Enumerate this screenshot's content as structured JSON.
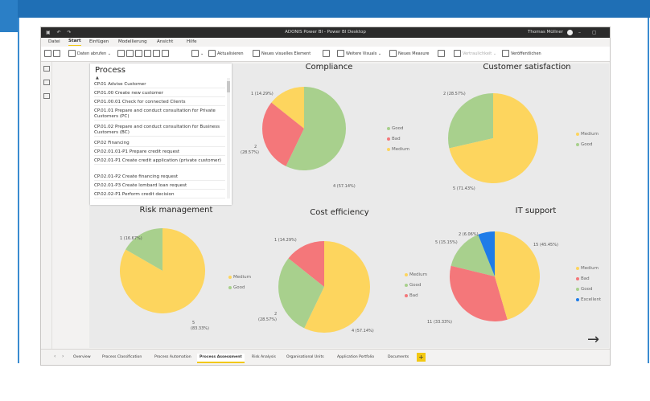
{
  "titlebar": {
    "title": "ADONIS Power BI - Power BI Desktop",
    "user": "Thomas Müllner",
    "qat": "▣ ↶ ↷",
    "window_controls": "– ▢ ✕"
  },
  "menu": [
    "Datei",
    "Start",
    "Einfügen",
    "Modellierung",
    "Ansicht",
    "Hilfe"
  ],
  "ribbon": {
    "get_data": "Daten abrufen",
    "refresh": "Aktualisieren",
    "new_visual": "Neues visuelles Element",
    "more_visuals": "Weitere Visuals",
    "new_measure": "Neues Measure",
    "sensitivity": "Vertraulichkeit",
    "publish": "Veröffentlichen"
  },
  "slicer": {
    "title": "Process",
    "sort_indicator": "▲",
    "items": [
      "CP.01 Advise Customer",
      "CP.01.00 Create new customer",
      "CP.01.00.01 Check for connected Clients",
      "CP.01.01 Prepare and conduct consultation for Private Customers (PC)",
      "CP.01.02 Prepare and conduct consultation for Business Customers (BC)",
      "CP.02 Financing",
      "CP.02.01.01-P1 Prepare credit request",
      "CP.02.01-P1 Create credit application (private customer)",
      "CP.02.01-P2 Create financing request",
      "CP.02.01-P3 Create lombard loan request",
      "CP.02.02-P1 Perform credit decision"
    ]
  },
  "colors": {
    "Good": "#a8d08d",
    "Bad": "#f4777a",
    "Medium": "#fdd55e",
    "Excellent": "#1f7ce8"
  },
  "chart_data": [
    {
      "type": "pie",
      "title": "Compliance",
      "slices": [
        {
          "label": "Medium",
          "value": 1,
          "percent": "14.29%",
          "text": "1 (14.29%)"
        },
        {
          "label": "Bad",
          "value": 2,
          "percent": "28.57%",
          "text": "2 (28.57%)"
        },
        {
          "label": "Good",
          "value": 4,
          "percent": "57.14%",
          "text": "4 (57.14%)"
        }
      ],
      "legend": [
        "Good",
        "Bad",
        "Medium"
      ],
      "legend_position": "right"
    },
    {
      "type": "pie",
      "title": "Customer satisfaction",
      "slices": [
        {
          "label": "Good",
          "value": 2,
          "percent": "28.57%",
          "text": "2 (28.57%)"
        },
        {
          "label": "Medium",
          "value": 5,
          "percent": "71.43%",
          "text": "5 (71.43%)"
        }
      ],
      "legend": [
        "Medium",
        "Good"
      ],
      "legend_position": "right"
    },
    {
      "type": "pie",
      "title": "Risk management",
      "slices": [
        {
          "label": "Good",
          "value": 1,
          "percent": "16.67%",
          "text": "1 (16.67%)"
        },
        {
          "label": "Medium",
          "value": 5,
          "percent": "83.33%",
          "text": "5 (83.33%)"
        }
      ],
      "legend": [
        "Medium",
        "Good"
      ],
      "legend_position": "right"
    },
    {
      "type": "pie",
      "title": "Cost efficiency",
      "slices": [
        {
          "label": "Bad",
          "value": 1,
          "percent": "14.29%",
          "text": "1 (14.29%)"
        },
        {
          "label": "Good",
          "value": 2,
          "percent": "28.57%",
          "text": "2 (28.57%)"
        },
        {
          "label": "Medium",
          "value": 4,
          "percent": "57.14%",
          "text": "4 (57.14%)"
        }
      ],
      "legend": [
        "Medium",
        "Good",
        "Bad"
      ],
      "legend_position": "left"
    },
    {
      "type": "pie",
      "title": "IT support",
      "slices": [
        {
          "label": "Excellent",
          "value": 2,
          "percent": "6.06%",
          "text": "2 (6.06%)"
        },
        {
          "label": "Good",
          "value": 5,
          "percent": "15.15%",
          "text": "5 (15.15%)"
        },
        {
          "label": "Bad",
          "value": 11,
          "percent": "33.33%",
          "text": "11 (33.33%)"
        },
        {
          "label": "Medium",
          "value": 15,
          "percent": "45.45%",
          "text": "15 (45.45%)"
        }
      ],
      "legend": [
        "Medium",
        "Bad",
        "Good",
        "Excellent"
      ],
      "legend_position": "right"
    }
  ],
  "labels": {
    "compliance": [
      "1 (14.29%)",
      "2",
      "(28.57%)",
      "4 (57.14%)"
    ],
    "customer": [
      "2 (28.57%)",
      "5 (71.43%)"
    ],
    "risk": [
      "1 (16.67%)",
      "5",
      "(83.33%)"
    ],
    "cost": [
      "1 (14.29%)",
      "2",
      "(28.57%)",
      "4 (57.14%)"
    ],
    "it": [
      "2 (6.06%)",
      "5 (15.15%)",
      "15 (45.45%)",
      "11 (33.33%)"
    ]
  },
  "tabs": [
    "Overview",
    "Process Classification",
    "Process Automation",
    "Process Assessment",
    "Risk Analysis",
    "Organisational Units",
    "Application Portfolio",
    "Documents"
  ],
  "active_tab": "Process Assessment",
  "tab_nav": [
    "‹",
    "›"
  ],
  "add_page": "+",
  "next_arrow": "→"
}
